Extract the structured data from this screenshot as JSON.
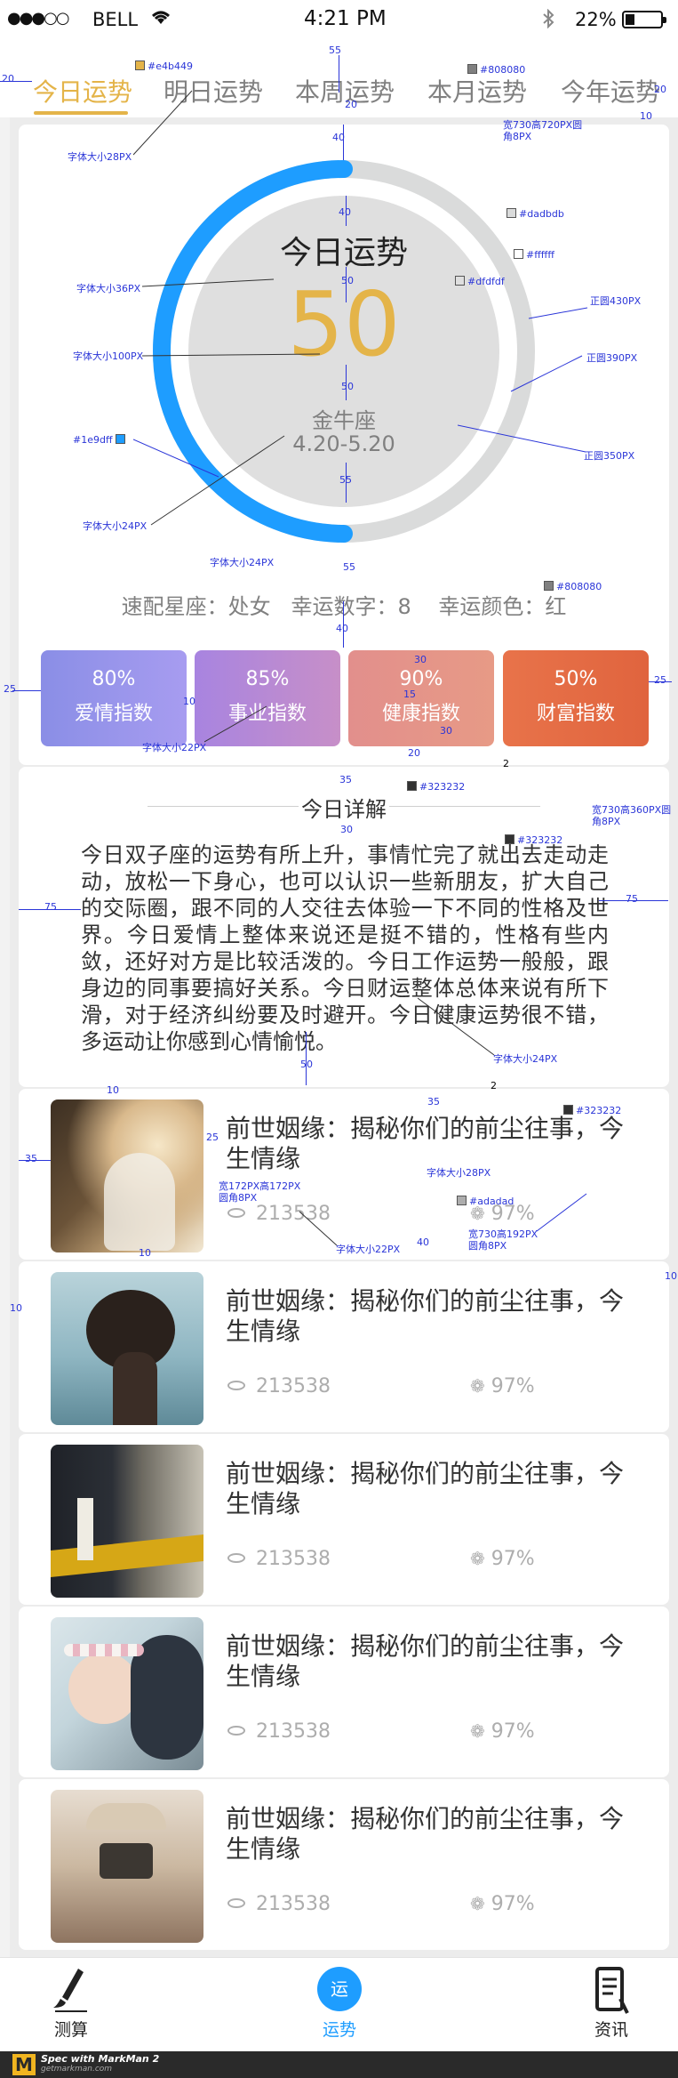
{
  "status_bar": {
    "signal": "●●●○○",
    "carrier": "BELL",
    "time": "4:21 PM",
    "battery": "22%"
  },
  "tabs": [
    {
      "label": "今日运势"
    },
    {
      "label": "明日运势"
    },
    {
      "label": "本周运势"
    },
    {
      "label": "本月运势"
    },
    {
      "label": "今年运势"
    }
  ],
  "fortune": {
    "title": "今日运势",
    "score": "50",
    "score_value": 50,
    "sign": "金牛座",
    "dates": "4.20-5.20"
  },
  "lucky_line": "速配星座：处女   幸运数字：8    幸运颜色：红",
  "indices": [
    {
      "value": "80%",
      "name": "爱情指数"
    },
    {
      "value": "85%",
      "name": "事业指数"
    },
    {
      "value": "90%",
      "name": "健康指数"
    },
    {
      "value": "50%",
      "name": "财富指数"
    }
  ],
  "detail": {
    "title": "今日详解",
    "body": "今日双子座的运势有所上升，事情忙完了就出去走动走动，放松一下身心，也可以认识一些新朋友，扩大自己的交际圈，跟不同的人交往去体验一下不同的性格及世界。今日爱情上整体来说还是挺不错的，性格有些内敛，还好对方是比较活泼的。今日工作运势一般般，跟身边的同事要搞好关系。今日财运整体总体来说有所下滑，对于经济纠纷要及时避开。今日健康运势很不错，多运动让你感到心情愉悦。"
  },
  "news": [
    {
      "title": "前世姻缘：揭秘你们的前尘往事，今生情缘",
      "views": "213538",
      "rate": "97%"
    },
    {
      "title": "前世姻缘：揭秘你们的前尘往事，今生情缘",
      "views": "213538",
      "rate": "97%"
    },
    {
      "title": "前世姻缘：揭秘你们的前尘往事，今生情缘",
      "views": "213538",
      "rate": "97%"
    },
    {
      "title": "前世姻缘：揭秘你们的前尘往事，今生情缘",
      "views": "213538",
      "rate": "97%"
    },
    {
      "title": "前世姻缘：揭秘你们的前尘往事，今生情缘",
      "views": "213538",
      "rate": "97%"
    }
  ],
  "bottom_nav": [
    {
      "label": "测算"
    },
    {
      "label": "运势",
      "badge": "运"
    },
    {
      "label": "资讯"
    }
  ],
  "footer": {
    "brand_line1": "Spec with MarkMan 2",
    "brand_line2": "getmarkman.com"
  },
  "specs": {
    "tab_accent": "#e4b449",
    "tab_gray": "#808080",
    "ring_bg": "#dadbdb",
    "inner_fill": "#ffffff",
    "inner_circle": "#dfdfdf",
    "ring_blue": "#1e9dff",
    "text_dark": "#323232",
    "meta_gray": "#adadad",
    "t1": "字体大小28PX",
    "t2": "字体大小36PX",
    "t3": "字体大小100PX",
    "t4": "字体大小24PX",
    "t5": "字体大小24PX",
    "t6": "字体大小22PX",
    "t7": "字体大小24PX",
    "t8": "字体大小28PX",
    "t9": "字体大小22PX",
    "size1a": "宽730高720PX圆",
    "size1b": "角8PX",
    "size2a": "宽730高360PX圆",
    "size2b": "角8PX",
    "size3a": "宽730高192PX",
    "size3b": "圆角8PX",
    "size4a": "宽172PX高172PX",
    "size4b": "圆角8PX",
    "circle430": "正圆430PX",
    "circle390": "正圆390PX",
    "circle350": "正圆350PX",
    "n20": "20",
    "n55": "55",
    "n10": "10",
    "n40": "40",
    "n50": "50",
    "n25": "25",
    "n30": "30",
    "n15": "15",
    "n35": "35",
    "n75": "75",
    "n2": "2"
  }
}
